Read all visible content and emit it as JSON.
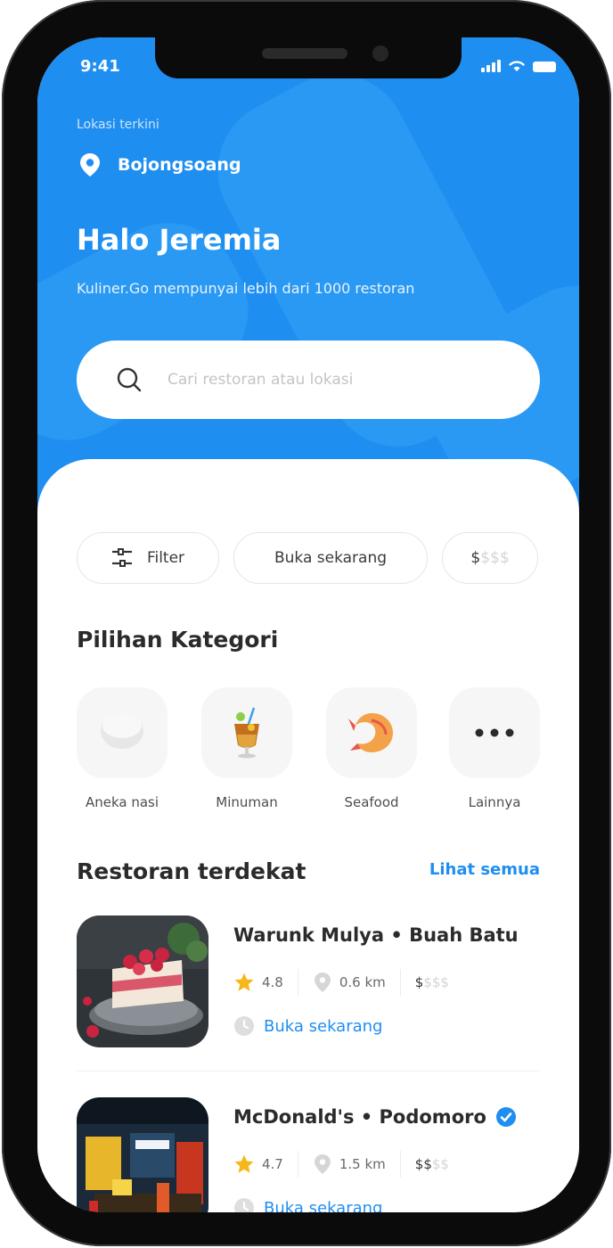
{
  "status_bar": {
    "time": "9:41"
  },
  "header": {
    "location_label": "Lokasi terkini",
    "location_name": "Bojongsoang",
    "greeting": "Halo Jeremia",
    "subtitle": "Kuliner.Go mempunyai lebih dari 1000 restoran"
  },
  "search": {
    "placeholder": "Cari restoran atau lokasi",
    "value": ""
  },
  "filters": {
    "filter_label": "Filter",
    "open_now_label": "Buka sekarang",
    "price_active": "$",
    "price_inactive": "$$$"
  },
  "categories": {
    "title": "Pilihan Kategori",
    "items": [
      {
        "label": "Aneka nasi",
        "icon": "rice-bowl-icon"
      },
      {
        "label": "Minuman",
        "icon": "drink-icon"
      },
      {
        "label": "Seafood",
        "icon": "shrimp-icon"
      },
      {
        "label": "Lainnya",
        "icon": "more-icon"
      }
    ]
  },
  "nearby": {
    "title": "Restoran terdekat",
    "see_all": "Lihat semua",
    "restaurants": [
      {
        "name": "Warunk Mulya • Buah Batu",
        "rating": "4.8",
        "distance": "0.6 km",
        "price_active": "$",
        "price_inactive": "$$$",
        "status": "Buka sekarang",
        "verified": false
      },
      {
        "name": "McDonald's • Podomoro",
        "rating": "4.7",
        "distance": "1.5 km",
        "price_active": "$$",
        "price_inactive": "$$",
        "status": "Buka sekarang",
        "verified": true
      }
    ]
  },
  "colors": {
    "primary": "#1f8ef1",
    "star": "#f5b71a",
    "text": "#2b2b2b"
  }
}
